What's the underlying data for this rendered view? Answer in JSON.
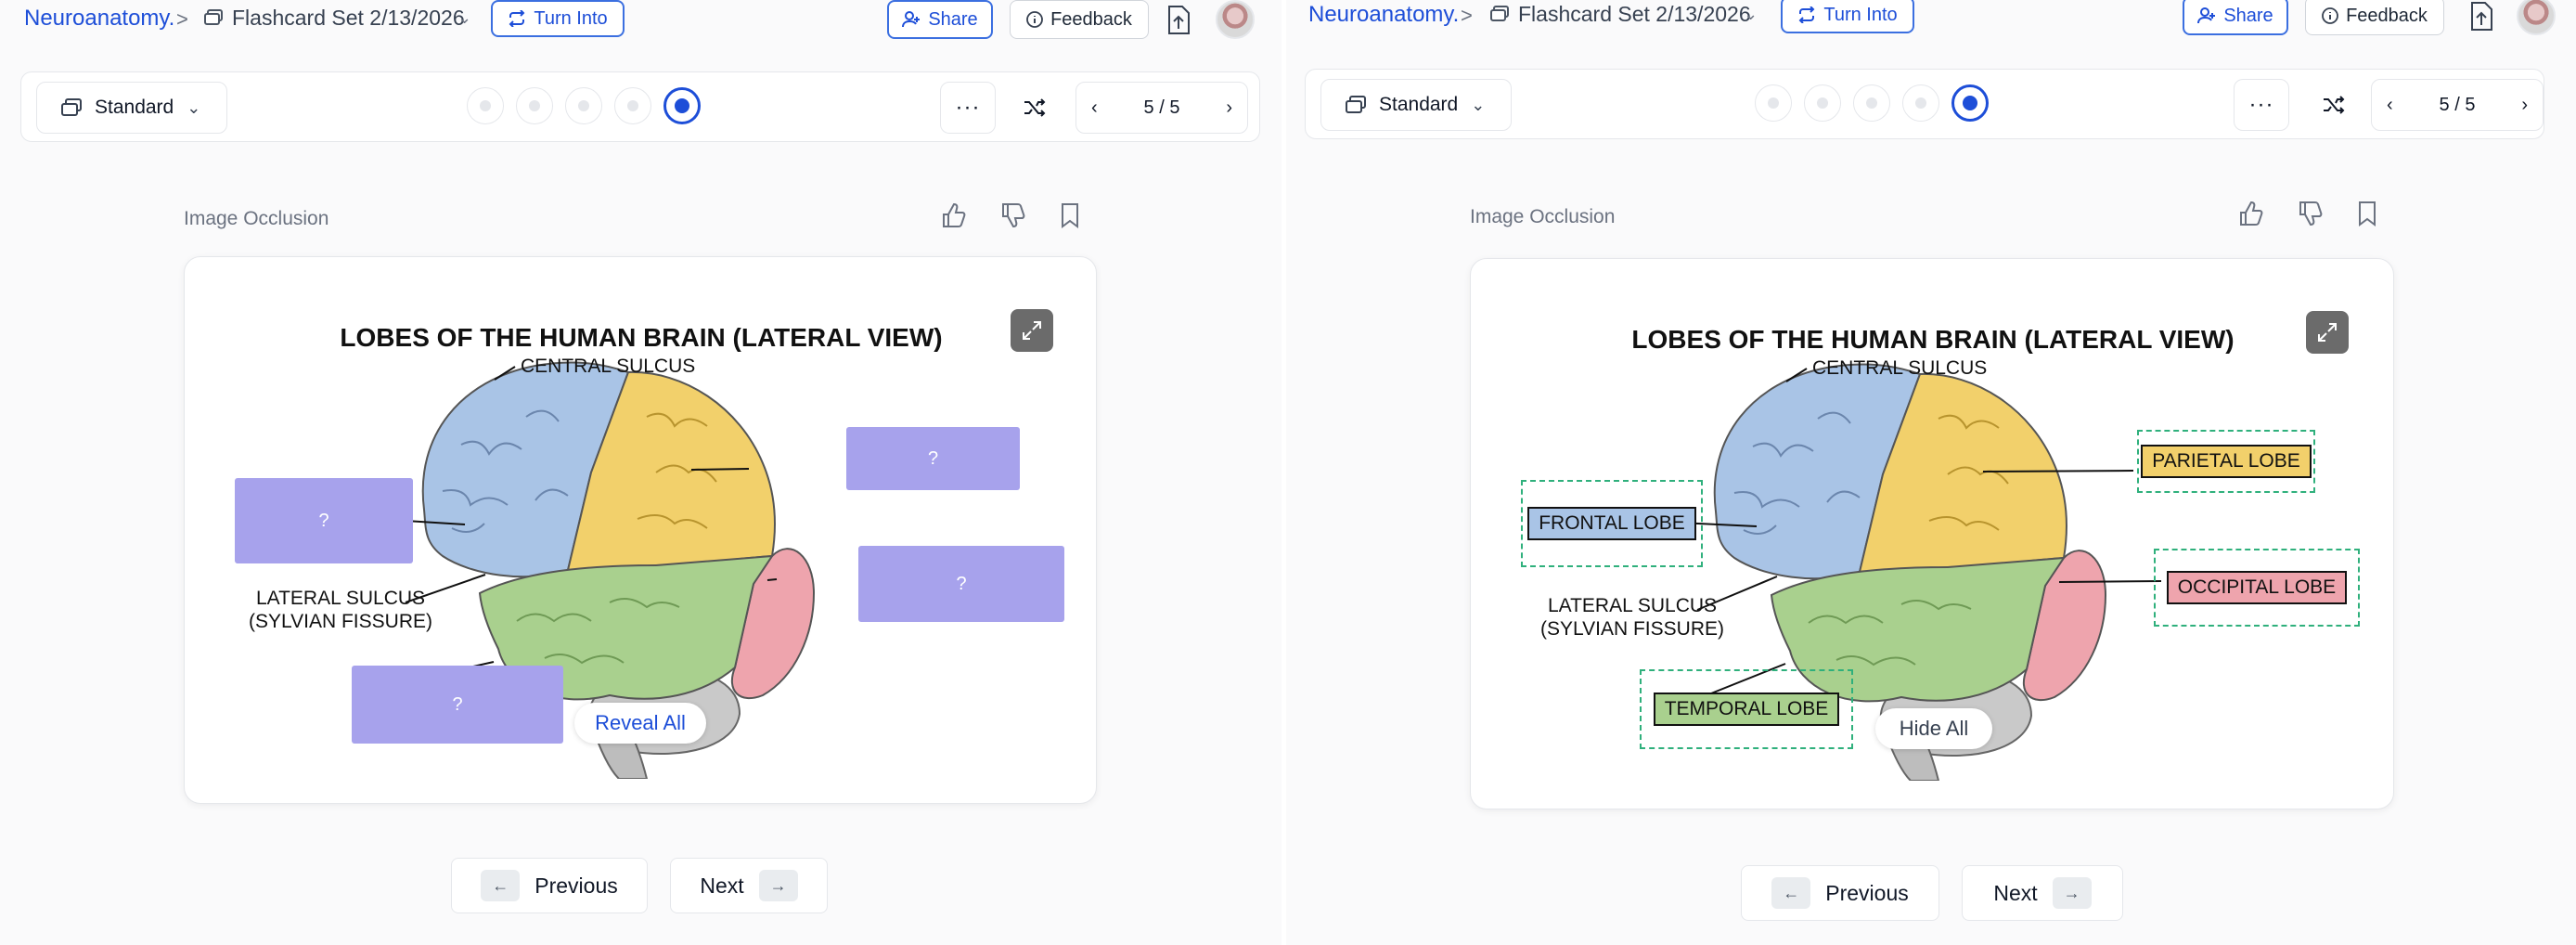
{
  "header": {
    "brand": "Neuroanatomy.",
    "separator": ">",
    "set_name": "Flashcard Set 2/13/2026",
    "turn_into": "Turn Into",
    "share": "Share",
    "feedback": "Feedback"
  },
  "toolbar": {
    "mode": "Standard",
    "more": "···",
    "progress": "5 / 5",
    "current_index": 5,
    "total": 5
  },
  "card": {
    "type_label": "Image Occlusion"
  },
  "diagram": {
    "title": "LOBES OF THE HUMAN BRAIN (LATERAL VIEW)",
    "central_sulcus": "CENTRAL SULCUS",
    "lateral_sulcus_line1": "LATERAL SULCUS",
    "lateral_sulcus_line2": "(SYLVIAN FISSURE)",
    "hidden_marker": "?",
    "frontal": "FRONTAL LOBE",
    "parietal": "PARIETAL LOBE",
    "occipital": "OCCIPITAL LOBE",
    "temporal": "TEMPORAL LOBE"
  },
  "left": {
    "toggle_label": "Reveal All"
  },
  "right": {
    "toggle_label": "Hide All"
  },
  "nav": {
    "previous": "Previous",
    "next": "Next",
    "prev_key": "←",
    "next_key": "→"
  },
  "colors": {
    "accent": "#1d4ed8",
    "occlusion": "#a7a2ec",
    "frontal": "#a9c4e6",
    "parietal": "#f2d06b",
    "temporal": "#a9d08e",
    "occipital": "#eea4ad",
    "cerebellum": "#c9c9c9",
    "answer_border": "#2fb07c"
  }
}
